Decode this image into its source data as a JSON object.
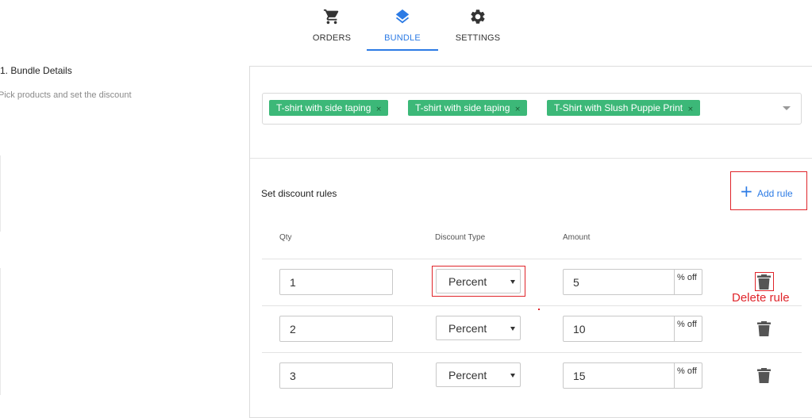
{
  "tabs": [
    {
      "label": "ORDERS",
      "icon": "cart-icon"
    },
    {
      "label": "BUNDLE",
      "icon": "layers-icon"
    },
    {
      "label": "SETTINGS",
      "icon": "gear-icon"
    }
  ],
  "section": {
    "title": "1. Bundle Details",
    "subtitle": "Pick products and set the discount"
  },
  "products": [
    {
      "label": "T-shirt with side taping",
      "remove": "×"
    },
    {
      "label": "T-shirt with side taping",
      "remove": "×"
    },
    {
      "label": "T-Shirt with Slush Puppie Print",
      "remove": "×"
    }
  ],
  "rules": {
    "title": "Set discount rules",
    "add_label": "Add rule",
    "add_icon": "+",
    "columns": {
      "qty": "Qty",
      "type": "Discount Type",
      "amount": "Amount"
    },
    "rows": [
      {
        "qty": "1",
        "type": "Percent",
        "amount": "5",
        "suffix": "% off"
      },
      {
        "qty": "2",
        "type": "Percent",
        "amount": "10",
        "suffix": "% off"
      },
      {
        "qty": "3",
        "type": "Percent",
        "amount": "15",
        "suffix": "% off"
      }
    ]
  },
  "annotation": {
    "delete_note": "Delete rule"
  },
  "colors": {
    "accent": "#2c7be5",
    "chip": "#3cb878",
    "annotation": "#e0242a"
  }
}
